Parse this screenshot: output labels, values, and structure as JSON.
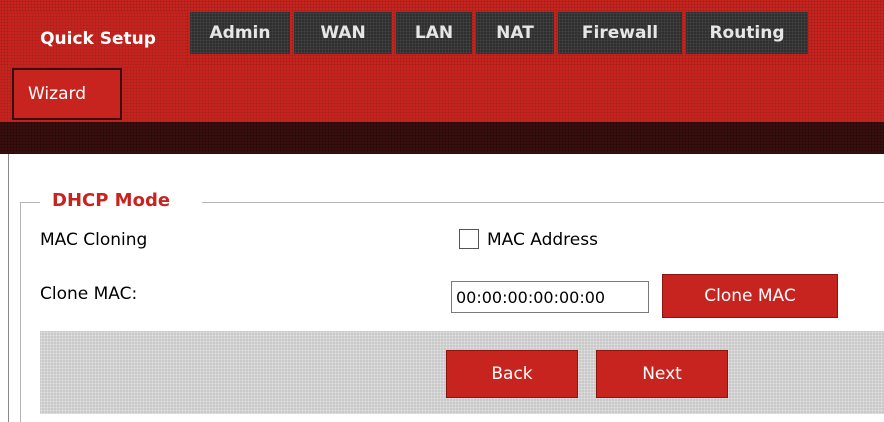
{
  "nav": {
    "tabs": [
      {
        "label": "Quick Setup",
        "active": true
      },
      {
        "label": "Admin"
      },
      {
        "label": "WAN"
      },
      {
        "label": "LAN"
      },
      {
        "label": "NAT"
      },
      {
        "label": "Firewall"
      },
      {
        "label": "Routing"
      }
    ],
    "subtabs": [
      {
        "label": "Wizard",
        "active": true
      }
    ]
  },
  "form": {
    "legend": "DHCP Mode",
    "mac_cloning_label": "MAC Cloning",
    "mac_address_checkbox_label": "MAC Address",
    "mac_address_checked": false,
    "clone_mac_label": "Clone MAC:",
    "clone_mac_value": "00:00:00:00:00:00",
    "clone_mac_button": "Clone MAC"
  },
  "actions": {
    "back_label": "Back",
    "next_label": "Next"
  },
  "colors": {
    "accent": "#c8241f",
    "tab_inactive": "#2f2f2f",
    "dark_bar": "#3a0e0c",
    "legend_text": "#c8241f"
  }
}
